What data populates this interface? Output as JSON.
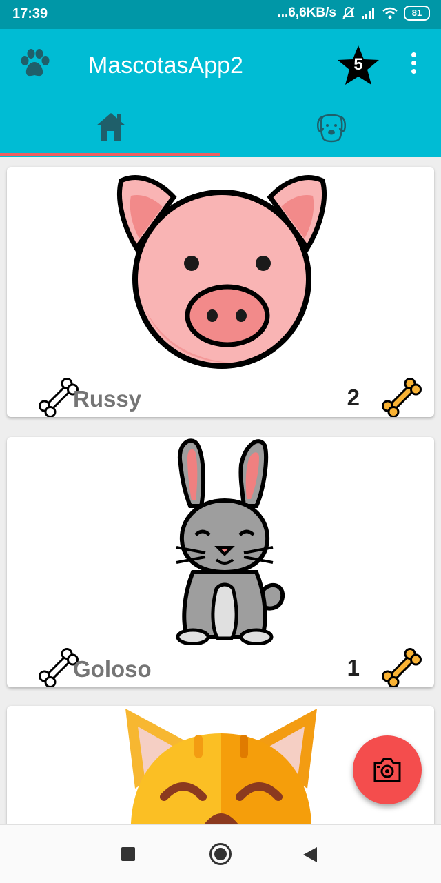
{
  "status_bar": {
    "time": "17:39",
    "network_speed": "...6,6KB/s",
    "battery_level": "81"
  },
  "app_bar": {
    "title": "MascotasApp2",
    "logo_icon": "paw-icon",
    "rating_badge": "5",
    "rating_icon": "star-icon",
    "menu_icon": "more-vert-icon"
  },
  "tabs": [
    {
      "icon": "home-icon",
      "selected": true
    },
    {
      "icon": "dog-face-icon",
      "selected": false
    }
  ],
  "colors": {
    "status_bar": "#0097a7",
    "app_bar": "#00bcd4",
    "tab_indicator": "#f06060",
    "fab": "#f44d4d",
    "bone_liked": "#f9b233"
  },
  "pets": [
    {
      "name": "Russy",
      "likes": "2",
      "image_icon": "pig-icon"
    },
    {
      "name": "Goloso",
      "likes": "1",
      "image_icon": "rabbit-icon"
    },
    {
      "name": "",
      "likes": "",
      "image_icon": "cat-icon"
    }
  ],
  "fab": {
    "icon": "camera-icon"
  },
  "nav_bar": {
    "buttons": [
      "recents-icon",
      "home-circle-icon",
      "back-icon"
    ]
  }
}
